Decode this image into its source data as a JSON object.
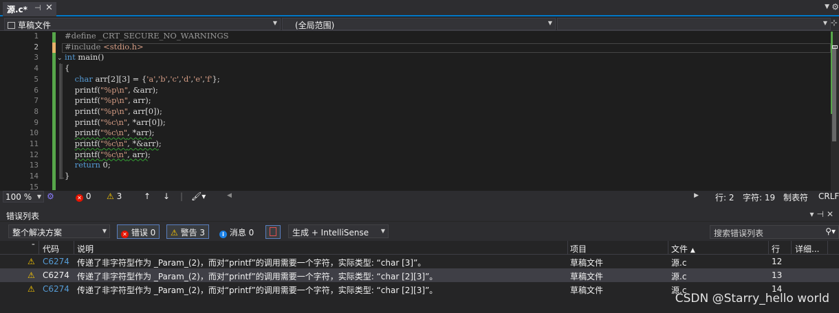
{
  "tab": {
    "title": "源.c*",
    "pin_icon": "pin-icon",
    "close_icon": "close-icon"
  },
  "navbar": {
    "project": "草稿文件",
    "scope": "(全局范围)",
    "member": ""
  },
  "editor": {
    "line_numbers": [
      "1",
      "2",
      "3",
      "4",
      "5",
      "6",
      "7",
      "8",
      "9",
      "10",
      "11",
      "12",
      "13",
      "14",
      "15"
    ],
    "active_line": 2,
    "lines": [
      {
        "segments": [
          {
            "t": "#define _CRT_SECURE_NO_WARNINGS",
            "c": "pp"
          }
        ]
      },
      {
        "segments": [
          {
            "t": "#include ",
            "c": "pp"
          },
          {
            "t": "<stdio.h>",
            "c": "str"
          }
        ]
      },
      {
        "segments": [
          {
            "t": "int",
            "c": "kw"
          },
          {
            "t": " main()",
            "c": "id"
          }
        ]
      },
      {
        "segments": [
          {
            "t": "{",
            "c": "id"
          }
        ]
      },
      {
        "segments": [
          {
            "t": "    ",
            "c": "id"
          },
          {
            "t": "char",
            "c": "kw"
          },
          {
            "t": " arr[2][3] = {",
            "c": "id"
          },
          {
            "t": "'a'",
            "c": "str"
          },
          {
            "t": ",",
            "c": "id"
          },
          {
            "t": "'b'",
            "c": "str"
          },
          {
            "t": ",",
            "c": "id"
          },
          {
            "t": "'c'",
            "c": "str"
          },
          {
            "t": ",",
            "c": "id"
          },
          {
            "t": "'d'",
            "c": "str"
          },
          {
            "t": ",",
            "c": "id"
          },
          {
            "t": "'e'",
            "c": "str"
          },
          {
            "t": ",",
            "c": "id"
          },
          {
            "t": "'f'",
            "c": "str"
          },
          {
            "t": "};",
            "c": "id"
          }
        ]
      },
      {
        "segments": [
          {
            "t": "    printf(",
            "c": "id"
          },
          {
            "t": "\"%p\\n\"",
            "c": "str"
          },
          {
            "t": ", &arr);",
            "c": "id"
          }
        ]
      },
      {
        "segments": [
          {
            "t": "    printf(",
            "c": "id"
          },
          {
            "t": "\"%p\\n\"",
            "c": "str"
          },
          {
            "t": ", arr);",
            "c": "id"
          }
        ]
      },
      {
        "segments": [
          {
            "t": "    printf(",
            "c": "id"
          },
          {
            "t": "\"%p\\n\"",
            "c": "str"
          },
          {
            "t": ", arr[0]);",
            "c": "id"
          }
        ]
      },
      {
        "segments": [
          {
            "t": "    printf(",
            "c": "id"
          },
          {
            "t": "\"%c\\n\"",
            "c": "str"
          },
          {
            "t": ", *arr[0]);",
            "c": "id"
          }
        ]
      },
      {
        "segments": [
          {
            "t": "    ",
            "c": "id"
          },
          {
            "t": "printf(",
            "c": "id squig"
          },
          {
            "t": "\"%c\\n\"",
            "c": "str squig"
          },
          {
            "t": ", *arr)",
            "c": "id squig"
          },
          {
            "t": ";",
            "c": "id"
          }
        ]
      },
      {
        "segments": [
          {
            "t": "    ",
            "c": "id"
          },
          {
            "t": "printf(",
            "c": "id squig"
          },
          {
            "t": "\"%c\\n\"",
            "c": "str squig"
          },
          {
            "t": ", *&arr)",
            "c": "id squig"
          },
          {
            "t": ";",
            "c": "id"
          }
        ]
      },
      {
        "segments": [
          {
            "t": "    ",
            "c": "id"
          },
          {
            "t": "printf(",
            "c": "id squig"
          },
          {
            "t": "\"%c\\n\"",
            "c": "str squig"
          },
          {
            "t": ", arr)",
            "c": "id squig"
          },
          {
            "t": ";",
            "c": "id"
          }
        ]
      },
      {
        "segments": [
          {
            "t": "    ",
            "c": "id"
          },
          {
            "t": "return",
            "c": "kw"
          },
          {
            "t": " 0;",
            "c": "id"
          }
        ]
      },
      {
        "segments": [
          {
            "t": "}",
            "c": "id"
          }
        ]
      },
      {
        "segments": []
      }
    ]
  },
  "status": {
    "zoom": "100 %",
    "errors": "0",
    "warnings": "3",
    "line": "行: 2",
    "char": "字符: 19",
    "tabs": "制表符",
    "eol": "CRLF"
  },
  "error_list": {
    "title": "错误列表",
    "scope": "整个解决方案",
    "errors_btn": "错误 0",
    "warnings_btn": "警告 3",
    "messages_btn": "消息 0",
    "build_source": "生成 + IntelliSense",
    "search_placeholder": "搜索错误列表",
    "columns": {
      "code": "代码",
      "desc": "说明",
      "project": "项目",
      "file": "文件",
      "line": "行",
      "detail": "详细..."
    },
    "rows": [
      {
        "code": "C6274",
        "desc": "传递了非字符型作为 _Param_(2)，而对“printf”的调用需要一个字符，实际类型: “char [3]”。",
        "project": "草稿文件",
        "file": "源.c",
        "line": "12"
      },
      {
        "code": "C6274",
        "desc": "传递了非字符型作为 _Param_(2)，而对“printf”的调用需要一个字符，实际类型: “char [2][3]”。",
        "project": "草稿文件",
        "file": "源.c",
        "line": "13"
      },
      {
        "code": "C6274",
        "desc": "传递了非字符型作为 _Param_(2)，而对“printf”的调用需要一个字符，实际类型: “char [2][3]”。",
        "project": "草稿文件",
        "file": "源.c",
        "line": "14"
      }
    ]
  },
  "watermark": "CSDN @Starry_hello world",
  "colors": {
    "accent": "#007acc",
    "warning": "#ffcc00",
    "error": "#e51400",
    "keyword": "#569cd6",
    "string": "#d69d85"
  }
}
